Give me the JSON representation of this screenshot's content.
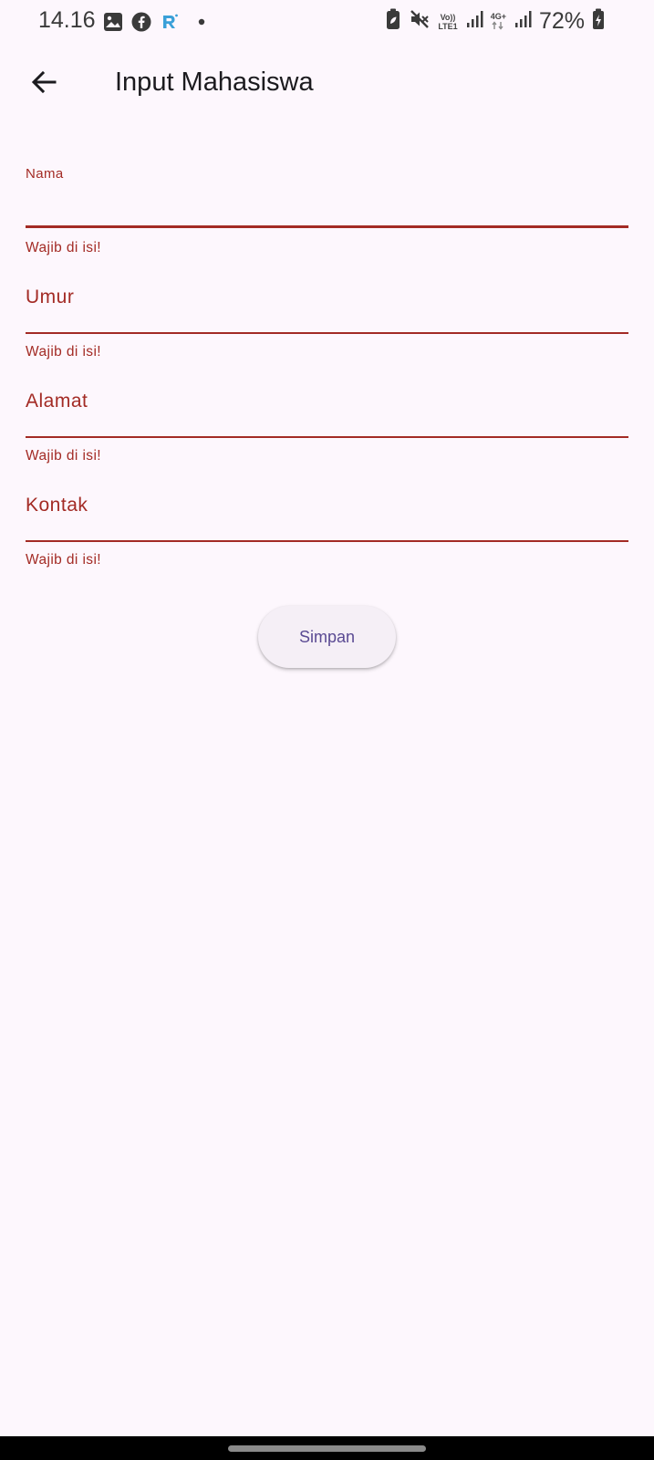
{
  "status_bar": {
    "time": "14.16",
    "lte_top": "Vo))",
    "lte_bottom": "LTE1",
    "net_type": "4G+",
    "battery_percent": "72%"
  },
  "app_bar": {
    "title": "Input Mahasiswa"
  },
  "form": {
    "fields": [
      {
        "label": "Nama",
        "error": "Wajib di isi!",
        "value": ""
      },
      {
        "label": "Umur",
        "error": "Wajib di isi!",
        "value": ""
      },
      {
        "label": "Alamat",
        "error": "Wajib di isi!",
        "value": ""
      },
      {
        "label": "Kontak",
        "error": "Wajib di isi!",
        "value": ""
      }
    ],
    "submit_label": "Simpan"
  },
  "colors": {
    "background": "#fdf7fd",
    "error": "#a32b25",
    "button_text": "#5a4a93",
    "button_bg": "#f5eff6"
  }
}
